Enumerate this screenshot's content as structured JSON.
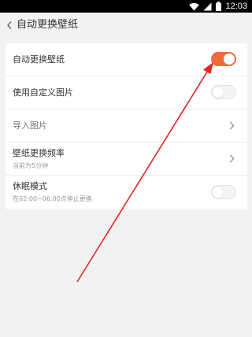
{
  "status_bar": {
    "time": "12:03",
    "icons": [
      "wifi-icon",
      "cellular-signal-icon",
      "battery-icon"
    ]
  },
  "header": {
    "back_icon": "chevron-left-icon",
    "title": "自动更换壁纸"
  },
  "settings": {
    "auto_change": {
      "label": "自动更换壁纸",
      "enabled": true
    },
    "custom_images": {
      "label": "使用自定义图片",
      "enabled": false
    },
    "import_images": {
      "label": "导入图片"
    },
    "frequency": {
      "label": "壁纸更换频率",
      "subtitle": "当前为5分钟"
    },
    "sleep_mode": {
      "label": "休眠模式",
      "subtitle": "在02:00~06:00点停止更换",
      "enabled": false
    }
  },
  "colors": {
    "accent": "#ee6a3b",
    "annotation_arrow": "#e52521",
    "background": "#f2f2f2"
  }
}
